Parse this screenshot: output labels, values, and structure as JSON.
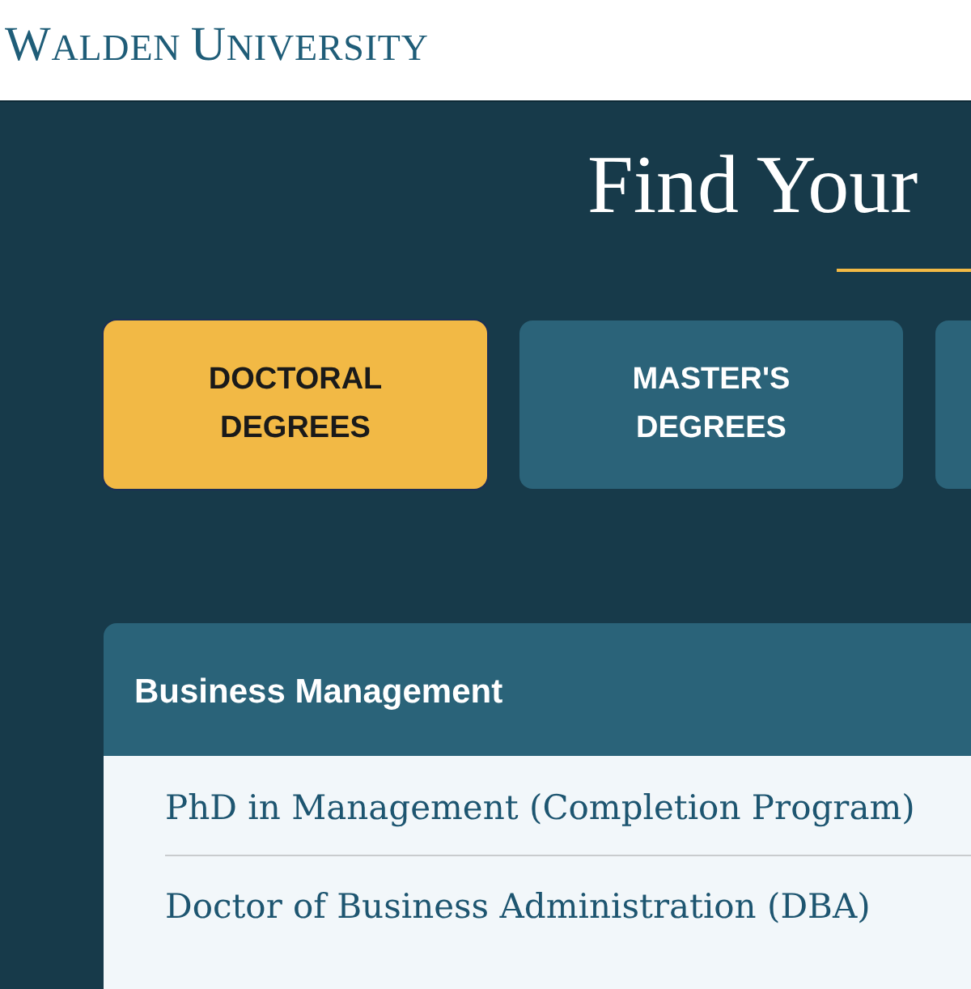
{
  "header": {
    "logo": "WALDEN UNIVERSITY"
  },
  "title": "Find Your",
  "tabs": [
    {
      "label": "DOCTORAL DEGREES",
      "selected": true
    },
    {
      "label": "MASTER'S DEGREES",
      "selected": false
    },
    {
      "selected": false
    }
  ],
  "panel": {
    "title": "Business Management",
    "programs": [
      "PhD in Management (Completion Program)",
      "Doctor of Business Administration (DBA)"
    ]
  }
}
